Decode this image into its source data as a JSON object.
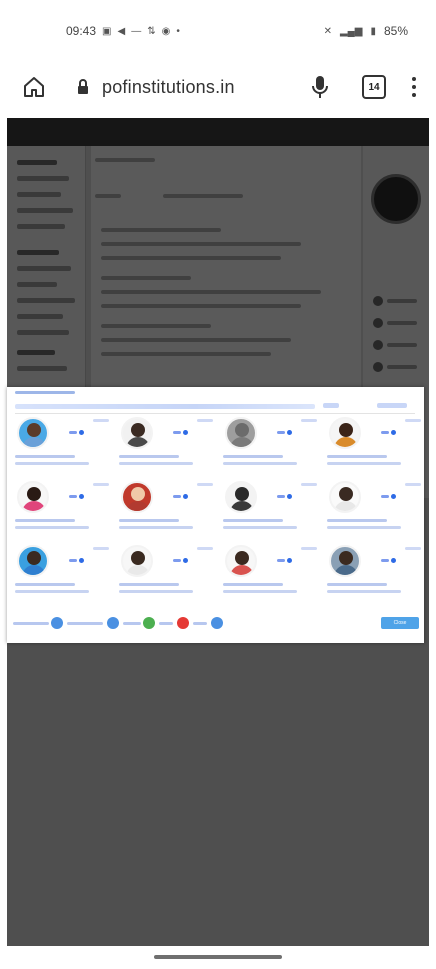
{
  "status_bar": {
    "time": "09:43",
    "left_icons": [
      "message-icon",
      "telegram-icon",
      "dash-icon",
      "network-icon",
      "app-icon",
      "dot-icon"
    ],
    "right_icons": [
      "mute-icon",
      "signal-icon",
      "battery-icon"
    ],
    "battery": "85%"
  },
  "browser": {
    "url": "pofinstitutions.in",
    "tab_count": "14"
  },
  "modal": {
    "staff": [
      {
        "colors": {
          "bg": "#4aa9e6",
          "head": "#5b3b2a",
          "body": "#6aa0d8"
        }
      },
      {
        "colors": {
          "bg": "#f1f1f1",
          "head": "#3a2a22",
          "body": "#4a4a4a"
        }
      },
      {
        "colors": {
          "bg": "#9e9e9e",
          "head": "#6b6b6b",
          "body": "#7a7a7a"
        }
      },
      {
        "colors": {
          "bg": "#f5f5f5",
          "head": "#3b2418",
          "body": "#d98b2b"
        }
      },
      {
        "colors": {
          "bg": "#f7f7f7",
          "head": "#2a1a14",
          "body": "#e0457b"
        }
      },
      {
        "colors": {
          "bg": "#c0392b",
          "head": "#f0c9a8",
          "body": "#b23a30"
        }
      },
      {
        "colors": {
          "bg": "#f3f3f3",
          "head": "#2a2a2a",
          "body": "#3a3a3a"
        }
      },
      {
        "colors": {
          "bg": "#fafafa",
          "head": "#3a2a22",
          "body": "#e8e8e8"
        }
      },
      {
        "colors": {
          "bg": "#3aa0e0",
          "head": "#3b2a20",
          "body": "#2f7fd0"
        }
      },
      {
        "colors": {
          "bg": "#f7f7f7",
          "head": "#3a2a20",
          "body": "#e9e9e9"
        }
      },
      {
        "colors": {
          "bg": "#f7f7f7",
          "head": "#3b2a20",
          "body": "#d9534f"
        }
      },
      {
        "colors": {
          "bg": "#8aa0b5",
          "head": "#3b2a20",
          "body": "#4a6a8a"
        }
      }
    ],
    "footer_icon_colors": [
      "#4a90e2",
      "#4a90e2",
      "#4caf50",
      "#e53935",
      "#4a90e2"
    ],
    "close_label": "Close"
  },
  "colors": {
    "accent": "#4fa3e8",
    "overlay": "rgba(0,0,0,0.62)"
  }
}
